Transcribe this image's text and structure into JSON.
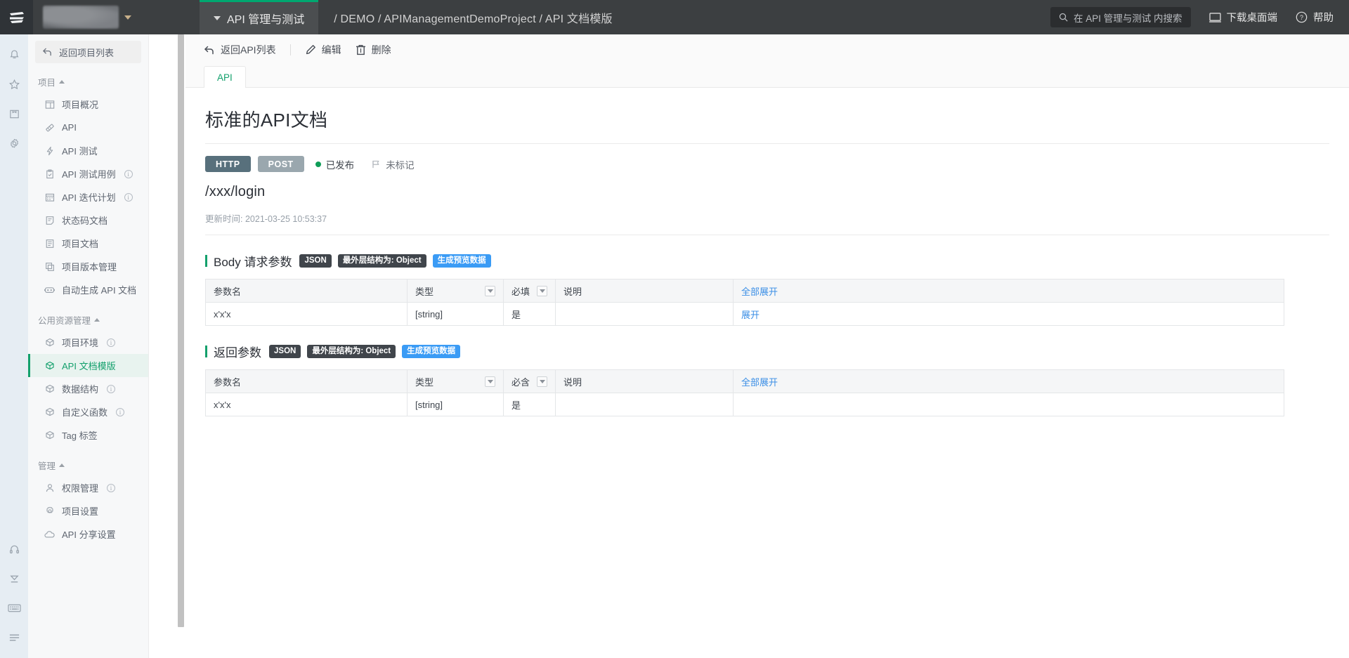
{
  "topbar": {
    "logo_icon": "hamburger-logo-icon",
    "org_chip": {
      "icon": "chevron-down-icon",
      "blurred": true
    },
    "app_switcher": {
      "label": "API 管理与测试",
      "icon": "chevron-down-icon"
    },
    "breadcrumb": "/ DEMO / APIManagementDemoProject / API 文档模版",
    "search": {
      "icon": "search-icon",
      "placeholder": "在 API 管理与测试 内搜索",
      "value": ""
    },
    "download_desktop": {
      "label": "下载桌面端",
      "icon": "monitor-icon"
    },
    "help": {
      "label": "帮助",
      "icon": "question-circle-icon"
    },
    "accent_green": "#00a870"
  },
  "rail": {
    "top_icons": [
      "bell-icon",
      "star-icon",
      "inbox-icon",
      "gear-icon"
    ],
    "bottom_icons": [
      "headset-icon",
      "collapse-icon",
      "keyboard-icon",
      "menu-icon"
    ]
  },
  "sidebar": {
    "back": {
      "label": "返回项目列表",
      "icon": "back-arrow-icon"
    },
    "groups": [
      {
        "title": "项目",
        "items": [
          {
            "label": "项目概况",
            "icon": "dashboard-icon",
            "info": false,
            "active": false
          },
          {
            "label": "API",
            "icon": "api-icon",
            "info": false,
            "active": false
          },
          {
            "label": "API 测试",
            "icon": "lightning-icon",
            "info": false,
            "active": false
          },
          {
            "label": "API 测试用例",
            "icon": "clipboard-check-icon",
            "info": true,
            "active": false
          },
          {
            "label": "API 迭代计划",
            "icon": "calendar-icon",
            "info": true,
            "active": false
          },
          {
            "label": "状态码文档",
            "icon": "note-icon",
            "info": false,
            "active": false
          },
          {
            "label": "项目文档",
            "icon": "document-icon",
            "info": false,
            "active": false
          },
          {
            "label": "项目版本管理",
            "icon": "layers-icon",
            "info": false,
            "active": false
          },
          {
            "label": "自动生成 API 文档",
            "icon": "robot-icon",
            "info": false,
            "active": false
          }
        ]
      },
      {
        "title": "公用资源管理",
        "items": [
          {
            "label": "项目环境",
            "icon": "cube-icon",
            "info": true,
            "active": false
          },
          {
            "label": "API 文档模版",
            "icon": "cube-icon",
            "info": false,
            "active": true
          },
          {
            "label": "数据结构",
            "icon": "cube-icon",
            "info": true,
            "active": false
          },
          {
            "label": "自定义函数",
            "icon": "cube-icon",
            "info": true,
            "active": false
          },
          {
            "label": "Tag 标签",
            "icon": "cube-icon",
            "info": false,
            "active": false
          }
        ]
      },
      {
        "title": "管理",
        "items": [
          {
            "label": "权限管理",
            "icon": "users-icon",
            "info": true,
            "active": false
          },
          {
            "label": "项目设置",
            "icon": "gear-icon",
            "info": false,
            "active": false
          },
          {
            "label": "API 分享设置",
            "icon": "cloud-icon",
            "info": false,
            "active": false
          }
        ]
      }
    ],
    "active_color": "#13a06c"
  },
  "main": {
    "toolbar": [
      {
        "label": "返回API列表",
        "icon": "back-arrow-icon"
      },
      {
        "label": "编辑",
        "icon": "pencil-icon"
      },
      {
        "label": "删除",
        "icon": "trash-icon"
      }
    ],
    "tabs": [
      {
        "label": "API",
        "active": true
      }
    ],
    "doc": {
      "title": "标准的API文档",
      "protocol_badge": {
        "label": "HTTP",
        "color": "#58707c"
      },
      "method_badge": {
        "label": "POST",
        "color": "#9aa7ae"
      },
      "status": {
        "label": "已发布",
        "dot_color": "#0f9d58"
      },
      "flag": {
        "label": "未标记",
        "icon": "flag-icon"
      },
      "path": "/xxx/login",
      "updated_label": "更新时间:",
      "updated_value": "2021-03-25 10:53:37"
    },
    "sections": [
      {
        "title": "Body 请求参数",
        "format_pill": "JSON",
        "structure_pill": "最外层结构为: Object",
        "preview_button": "生成预览数据",
        "columns": [
          "参数名",
          "类型",
          "必填",
          "说明",
          ""
        ],
        "column_filters": [
          false,
          true,
          true,
          false,
          false
        ],
        "expand_all": "全部展开",
        "rows": [
          {
            "name": "x'x'x",
            "type": "[string]",
            "required": "是",
            "desc": "",
            "action": "展开"
          }
        ]
      },
      {
        "title": "返回参数",
        "format_pill": "JSON",
        "structure_pill": "最外层结构为: Object",
        "preview_button": "生成预览数据",
        "columns": [
          "参数名",
          "类型",
          "必含",
          "说明",
          ""
        ],
        "column_filters": [
          false,
          true,
          true,
          false,
          false
        ],
        "expand_all": "全部展开",
        "rows": [
          {
            "name": "x'x'x",
            "type": "[string]",
            "required": "是",
            "desc": "",
            "action": ""
          }
        ]
      }
    ]
  }
}
